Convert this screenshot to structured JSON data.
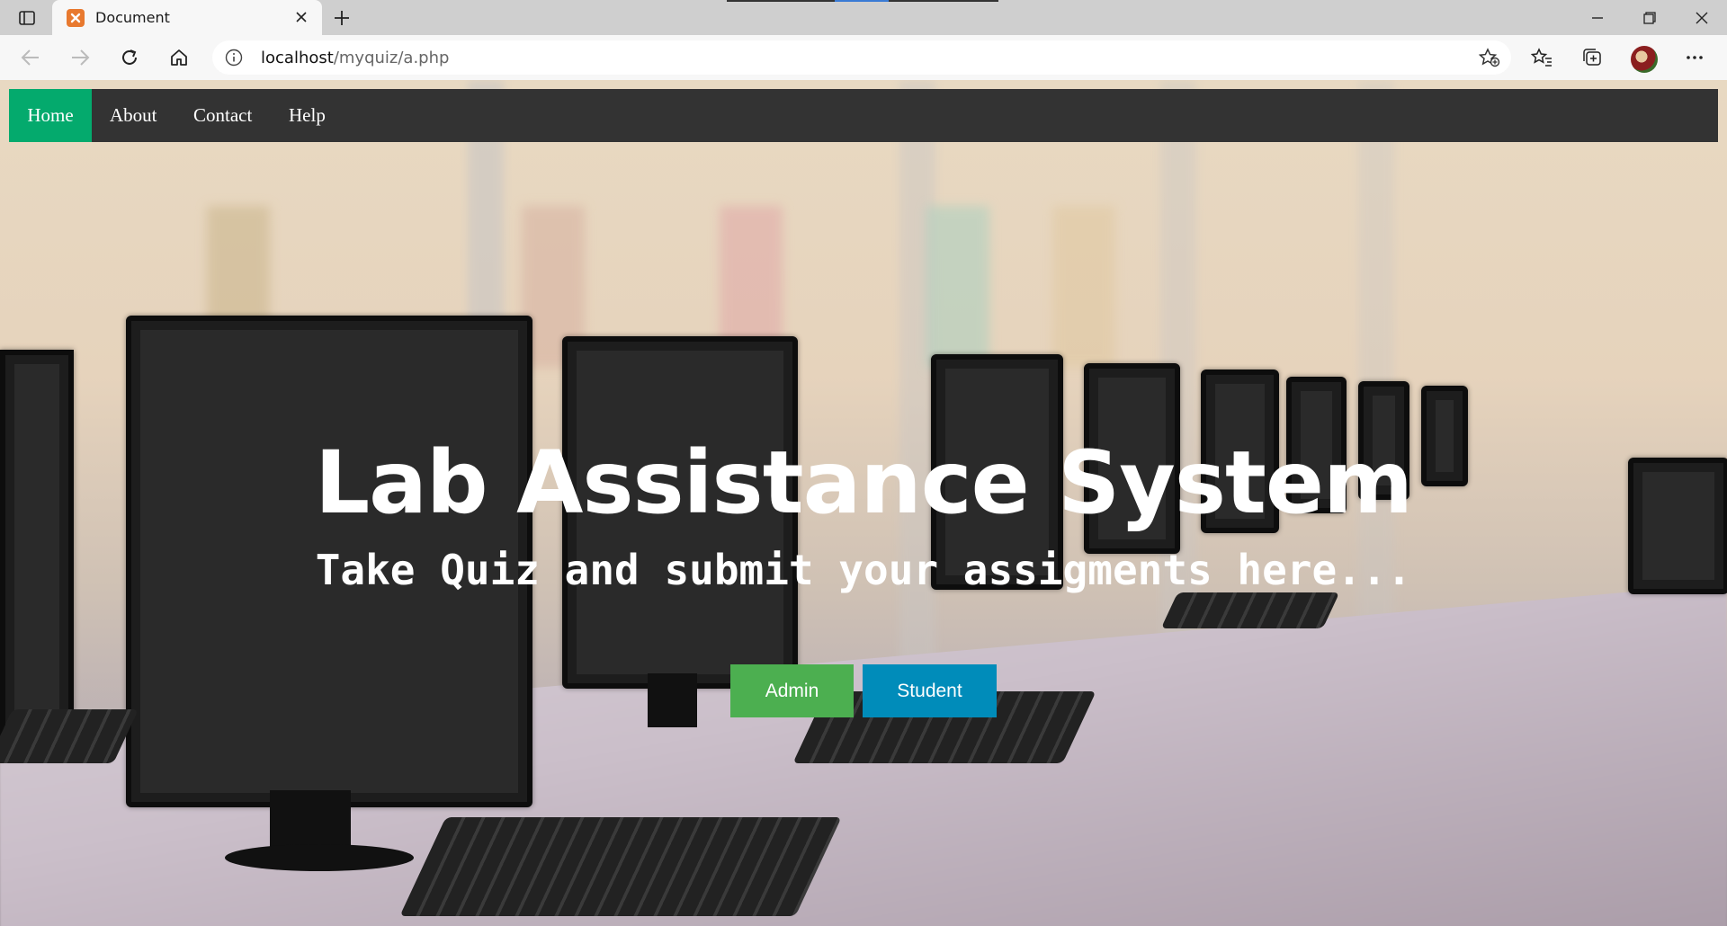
{
  "browser": {
    "tab_title": "Document",
    "url_host": "localhost",
    "url_path": "/myquiz/a.php"
  },
  "nav": {
    "items": [
      {
        "label": "Home",
        "active": true
      },
      {
        "label": "About",
        "active": false
      },
      {
        "label": "Contact",
        "active": false
      },
      {
        "label": "Help",
        "active": false
      }
    ]
  },
  "hero": {
    "title": "Lab Assistance System",
    "subtitle": "Take Quiz and submit your assigments here...",
    "buttons": {
      "admin": "Admin",
      "student": "Student"
    }
  },
  "colors": {
    "nav_bg": "#333333",
    "nav_active": "#04aa6d",
    "admin_button": "#4caf50",
    "student_button": "#008cba"
  }
}
